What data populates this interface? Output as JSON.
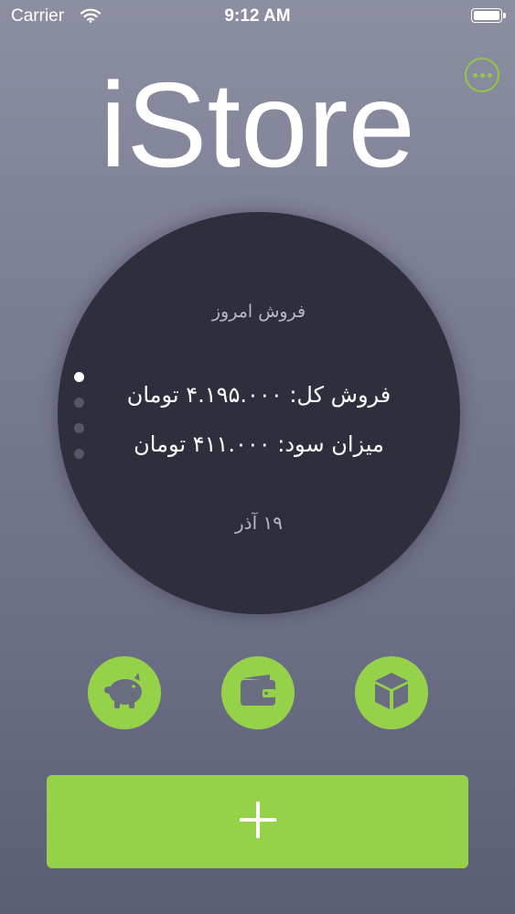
{
  "status_bar": {
    "carrier": "Carrier",
    "time": "9:12 AM"
  },
  "app": {
    "title": "iStore"
  },
  "sales_card": {
    "heading": "فروش امروز",
    "total_sales": "فروش کل: ۴.۱۹۵.۰۰۰ تومان",
    "profit": "میزان سود: ۴۱۱.۰۰۰ تومان",
    "date": "۱۹ آذر",
    "page_count": 4,
    "active_page": 1
  },
  "actions": {
    "savings_icon": "piggy-bank-icon",
    "wallet_icon": "wallet-icon",
    "inventory_icon": "box-icon",
    "add_icon": "plus-icon"
  },
  "colors": {
    "accent": "#96d14a",
    "circle": "#2e2f3d",
    "background_top": "#8c8ea1",
    "background_bottom": "#5b5d72"
  }
}
